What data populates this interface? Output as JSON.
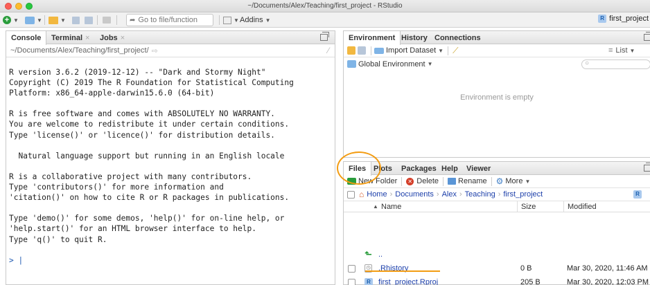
{
  "window": {
    "title": "~/Documents/Alex/Teaching/first_project - RStudio"
  },
  "toolbar": {
    "goto_placeholder": "Go to file/function",
    "addins_label": "Addins",
    "project_label": "first_project"
  },
  "console_pane": {
    "tabs": [
      {
        "label": "Console"
      },
      {
        "label": "Terminal"
      },
      {
        "label": "Jobs"
      }
    ],
    "path": "~/Documents/Alex/Teaching/first_project/",
    "lines": [
      "R version 3.6.2 (2019-12-12) -- \"Dark and Stormy Night\"",
      "Copyright (C) 2019 The R Foundation for Statistical Computing",
      "Platform: x86_64-apple-darwin15.6.0 (64-bit)",
      "",
      "R is free software and comes with ABSOLUTELY NO WARRANTY.",
      "You are welcome to redistribute it under certain conditions.",
      "Type 'license()' or 'licence()' for distribution details.",
      "",
      "  Natural language support but running in an English locale",
      "",
      "R is a collaborative project with many contributors.",
      "Type 'contributors()' for more information and",
      "'citation()' on how to cite R or R packages in publications.",
      "",
      "Type 'demo()' for some demos, 'help()' for on-line help, or",
      "'help.start()' for an HTML browser interface to help.",
      "Type 'q()' to quit R.",
      ""
    ],
    "prompt": ">"
  },
  "env_pane": {
    "tabs": [
      {
        "label": "Environment"
      },
      {
        "label": "History"
      },
      {
        "label": "Connections"
      }
    ],
    "import_label": "Import Dataset",
    "list_label": "List",
    "scope_label": "Global Environment",
    "empty_text": "Environment is empty"
  },
  "files_pane": {
    "tabs": [
      {
        "label": "Files"
      },
      {
        "label": "Plots"
      },
      {
        "label": "Packages"
      },
      {
        "label": "Help"
      },
      {
        "label": "Viewer"
      }
    ],
    "actions": {
      "new_folder": "New Folder",
      "delete": "Delete",
      "rename": "Rename",
      "more": "More"
    },
    "breadcrumb": [
      "Home",
      "Documents",
      "Alex",
      "Teaching",
      "first_project"
    ],
    "columns": {
      "name": "Name",
      "size": "Size",
      "modified": "Modified"
    },
    "up_label": "..",
    "rows": [
      {
        "name": ".Rhistory",
        "size": "0 B",
        "modified": "Mar 30, 2020, 11:46 AM"
      },
      {
        "name": "first_project.Rproj",
        "size": "205 B",
        "modified": "Mar 30, 2020, 12:03 PM"
      }
    ]
  },
  "colors": {
    "accent": "#f39c12",
    "link": "#1c3faa",
    "prompt": "#1c57b0"
  }
}
